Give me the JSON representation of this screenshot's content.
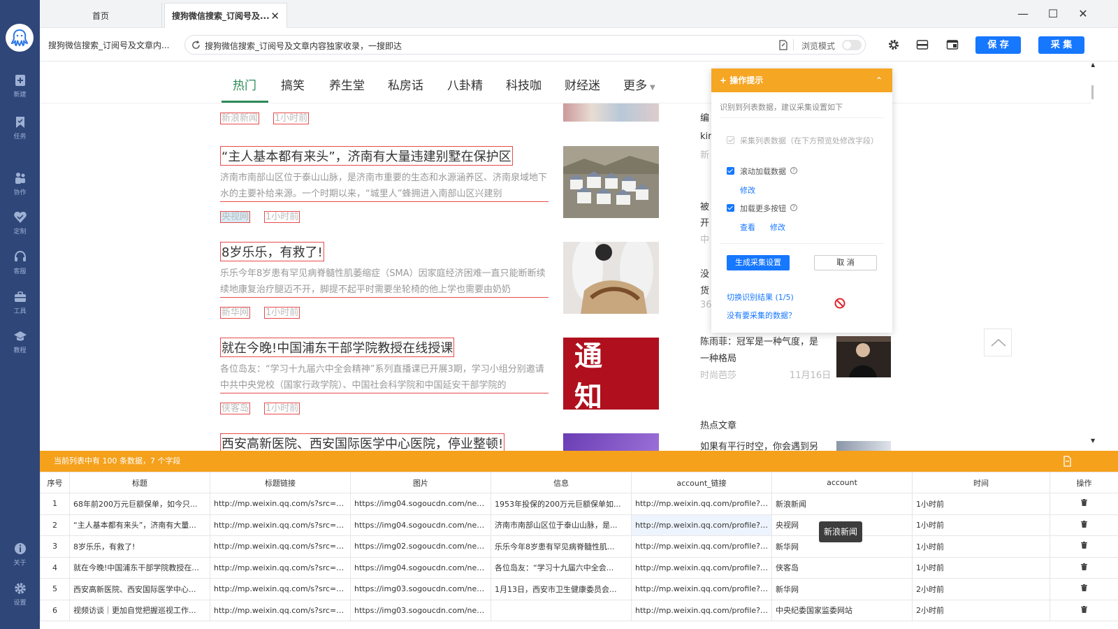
{
  "sidebar": {
    "items": [
      {
        "label": "新建",
        "icon": "plus-doc-icon"
      },
      {
        "label": "任务",
        "icon": "bookmark-icon"
      },
      {
        "label": "协作",
        "icon": "people-icon"
      },
      {
        "label": "定制",
        "icon": "heart-shield-icon"
      },
      {
        "label": "客服",
        "icon": "headset-icon"
      },
      {
        "label": "工具",
        "icon": "toolbox-icon"
      },
      {
        "label": "教程",
        "icon": "graduation-icon"
      },
      {
        "label": "关于",
        "icon": "info-icon"
      },
      {
        "label": "设置",
        "icon": "gear-icon"
      }
    ]
  },
  "tabs": {
    "home": "首页",
    "active": "搜狗微信搜索_订阅号及..."
  },
  "address": {
    "page_title": "搜狗微信搜索_订阅号及文章内...",
    "url": "搜狗微信搜索_订阅号及文章内容独家收录，一搜即达",
    "browse_mode": "浏览模式"
  },
  "toolbar": {
    "save_label": "保 存",
    "collect_label": "采 集"
  },
  "categories": [
    "热门",
    "搞笑",
    "养生堂",
    "私房话",
    "八卦精",
    "科技咖",
    "财经迷",
    "更多"
  ],
  "articles": [
    {
      "title": "",
      "desc": "",
      "source": "新浪新闻",
      "time": "1小时前"
    },
    {
      "title": "“主人基本都有来头”，济南有大量违建别墅在保护区",
      "desc": "济南市南部山区位于泰山山脉，是济南市重要的生态和水源涵养区、济南泉域地下水的主要补给来源。一个时期以来，“城里人”蜂拥进入南部山区兴建别",
      "source": "央视网",
      "time": "1小时前"
    },
    {
      "title": "8岁乐乐，有救了!",
      "desc": "乐乐今年8岁患有罕见病脊髓性肌萎缩症（SMA）因家庭经济困难一直只能断断续续地康复治疗腿迈不开，脚提不起平时需要坐轮椅的他上学也需要由奶奶",
      "source": "新华网",
      "time": "1小时前"
    },
    {
      "title": "就在今晚!中国浦东干部学院教授在线授课",
      "desc": "各位岛友：“学习十九届六中全会精神”系列直播课已开展3期，学习小组分别邀请中共中央党校（国家行政学院）、中国社会科学院和中国延安干部学院的",
      "source": "侠客岛",
      "time": "1小时前"
    },
    {
      "title": "西安高新医院、西安国际医学中心医院，停业整顿!",
      "desc": "",
      "source": "",
      "time": ""
    }
  ],
  "notice_image_text": "通 知",
  "right_column": {
    "frag1": "编",
    "frag2": "kin",
    "frag3": "新",
    "frag4": "被",
    "frag5": "开",
    "frag6": "中",
    "frag7": "没",
    "frag8": "货",
    "frag9": "36",
    "card_title_1": "陈雨菲：冠军是一种气度，是",
    "card_title_2": "一种格局",
    "card_source": "时尚芭莎",
    "card_date": "11月16日",
    "hot_heading": "热点文章",
    "hot_first": "如果有平行时空，你会遇到另"
  },
  "hint": {
    "title": "操作提示",
    "subtitle": "识别到列表数据，建议采集设置如下",
    "opt1": "采集列表数据（在下方预览处修改字段）",
    "opt2": "滚动加载数据",
    "opt3": "加载更多按钮",
    "modify": "修改",
    "view": "查看",
    "generate": "生成采集设置",
    "cancel": "取 消",
    "switch": "切换识别结果 (1/5)",
    "no_data": "没有要采集的数据？"
  },
  "databar": {
    "text": "当前列表中有 100 条数据，7 个字段"
  },
  "table": {
    "headers": [
      "序号",
      "标题",
      "标题链接",
      "图片",
      "信息",
      "account_链接",
      "account",
      "时间",
      "操作"
    ],
    "rows": [
      [
        "1",
        "68年前200万元巨额保单，如今只...",
        "http://mp.weixin.qq.com/s?src=11...",
        "https://img04.sogoucdn.com/net/...",
        "1953年投保的200万元巨额保单如...",
        "http://mp.weixin.qq.com/profile?sr...",
        "新浪新闻",
        "1小时前"
      ],
      [
        "2",
        "“主人基本都有来头”，济南有大量...",
        "http://mp.weixin.qq.com/s?src=11...",
        "https://img04.sogoucdn.com/net/...",
        "济南市南部山区位于泰山山脉，是...",
        "http://mp.weixin.qq.com/profile?sr...",
        "央视网",
        "1小时前"
      ],
      [
        "3",
        "8岁乐乐，有救了!",
        "http://mp.weixin.qq.com/s?src=11...",
        "https://img02.sogoucdn.com/net/...",
        "乐乐今年8岁患有罕见病脊髓性肌...",
        "http://mp.weixin.qq.com/profile?sr...",
        "新华网",
        "1小时前"
      ],
      [
        "4",
        "就在今晚!中国浦东干部学院教授在...",
        "http://mp.weixin.qq.com/s?src=11...",
        "https://img04.sogoucdn.com/net/...",
        "各位岛友：“学习十九届六中全会...",
        "http://mp.weixin.qq.com/profile?sr...",
        "侠客岛",
        "1小时前"
      ],
      [
        "5",
        "西安高新医院、西安国际医学中心...",
        "http://mp.weixin.qq.com/s?src=11...",
        "https://img03.sogoucdn.com/net/...",
        "1月13日，西安市卫生健康委员会...",
        "http://mp.weixin.qq.com/profile?sr...",
        "新华网",
        "2小时前"
      ],
      [
        "6",
        "视频访谈｜更加自觉把握巡视工作...",
        "http://mp.weixin.qq.com/s?src=11...",
        "https://img03.sogoucdn.com/net/...",
        "",
        "http://mp.weixin.qq.com/profile?sr...",
        "中央纪委国家监委网站",
        "2小时前"
      ]
    ]
  },
  "tooltip": "新浪新闻",
  "colors": {
    "sidebar": "#2f4679",
    "accent_blue": "#1677ff",
    "orange": "#f5a11c",
    "green_active": "#2d8a57",
    "red_outline": "#e84b4b"
  }
}
